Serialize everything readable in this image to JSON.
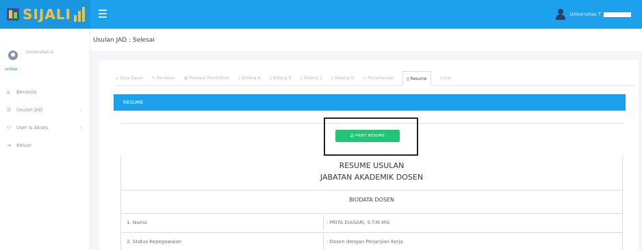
{
  "brand": {
    "name": "SIJALI"
  },
  "topbar": {
    "user_name": "Universitas T"
  },
  "sidebar": {
    "user": {
      "name": "Universitas G",
      "status": "online"
    },
    "items": [
      {
        "icon": "home-icon",
        "glyph": "⌂",
        "label": "Beranda",
        "has_caret": false
      },
      {
        "icon": "list-icon",
        "glyph": "☷",
        "label": "Usulan JAD",
        "has_caret": true
      },
      {
        "icon": "users-icon",
        "glyph": "⚇",
        "label": "User & Akses",
        "has_caret": true
      },
      {
        "icon": "logout-icon",
        "glyph": "⇥",
        "label": "Keluar",
        "has_caret": false
      }
    ]
  },
  "header": {
    "breadcrumb": "Usulan JAD : Selesai"
  },
  "tabs": [
    {
      "icon": "⊿",
      "label": "Data Dasar",
      "active": false
    },
    {
      "icon": "✎",
      "label": "Penilaian",
      "active": false
    },
    {
      "icon": "▤",
      "label": "Riwayat Pendidikan",
      "active": false
    },
    {
      "icon": "▯",
      "label": "Bidang A",
      "active": false
    },
    {
      "icon": "▯",
      "label": "Bidang B",
      "active": false
    },
    {
      "icon": "▯",
      "label": "Bidang C",
      "active": false
    },
    {
      "icon": "▯",
      "label": "Bidang D",
      "active": false
    },
    {
      "icon": "▭",
      "label": "Penyetaraan",
      "active": false
    },
    {
      "icon": "▯",
      "label": "Resume",
      "active": true
    },
    {
      "icon": "▯",
      "label": "Log",
      "active": false
    }
  ],
  "section": {
    "title": "RESUME"
  },
  "print_button": {
    "label": "PRINT RESUME",
    "icon": "print-icon"
  },
  "document": {
    "title_line1": "RESUME USULAN",
    "title_line2": "JABATAN AKADEMIK DOSEN",
    "subtitle": "BIODATA DOSEN",
    "rows": [
      {
        "label": "1. Nama",
        "value": ": PRITA DIASARI, S.T.M.MSi"
      },
      {
        "label": "2. Status Kepegawaian",
        "value": ": Dosen dengan Perjanjian Kerja"
      }
    ]
  },
  "colors": {
    "primary": "#1ea1ec",
    "success": "#22c575",
    "brand_text": "#f5c33b"
  }
}
